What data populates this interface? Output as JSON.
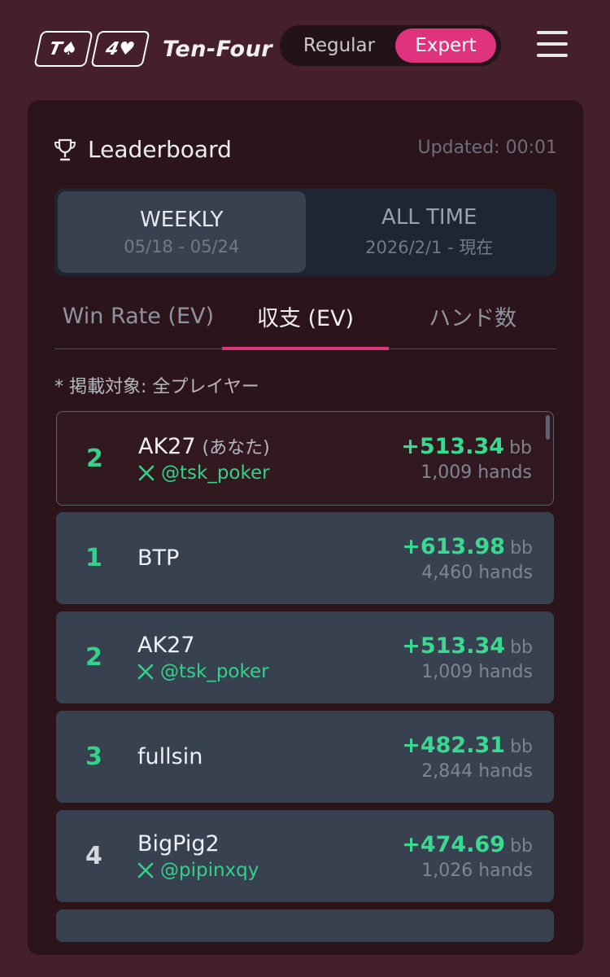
{
  "header": {
    "logo_cards": [
      "T♠",
      "4♥"
    ],
    "brand": "Ten-Four",
    "modes": [
      "Regular",
      "Expert"
    ],
    "active_mode": "Expert"
  },
  "leaderboard": {
    "title": "Leaderboard",
    "updated": "Updated: 00:01",
    "periods": [
      {
        "label": "WEEKLY",
        "range": "05/18 - 05/24"
      },
      {
        "label": "ALL TIME",
        "range": "2026/2/1 - 現在"
      }
    ],
    "metric_tabs": [
      "Win Rate (EV)",
      "収支 (EV)",
      "ハンド数"
    ],
    "note": "* 掲載対象: 全プレイヤー",
    "me": {
      "rank": "2",
      "name": "AK27",
      "you": "(あなた)",
      "handle": "@tsk_poker",
      "profit": "+513.34",
      "unit": "bb",
      "hands": "1,009 hands"
    },
    "rows": [
      {
        "rank": "1",
        "name": "BTP",
        "handle": "",
        "profit": "+613.98",
        "unit": "bb",
        "hands": "4,460 hands"
      },
      {
        "rank": "2",
        "name": "AK27",
        "handle": "@tsk_poker",
        "profit": "+513.34",
        "unit": "bb",
        "hands": "1,009 hands"
      },
      {
        "rank": "3",
        "name": "fullsin",
        "handle": "",
        "profit": "+482.31",
        "unit": "bb",
        "hands": "2,844 hands"
      },
      {
        "rank": "4",
        "name": "BigPig2",
        "handle": "@pipinxqy",
        "profit": "+474.69",
        "unit": "bb",
        "hands": "1,026 hands"
      }
    ]
  },
  "colors": {
    "accent": "#e0337d",
    "positive": "#39d98f",
    "background": "#45202a"
  }
}
